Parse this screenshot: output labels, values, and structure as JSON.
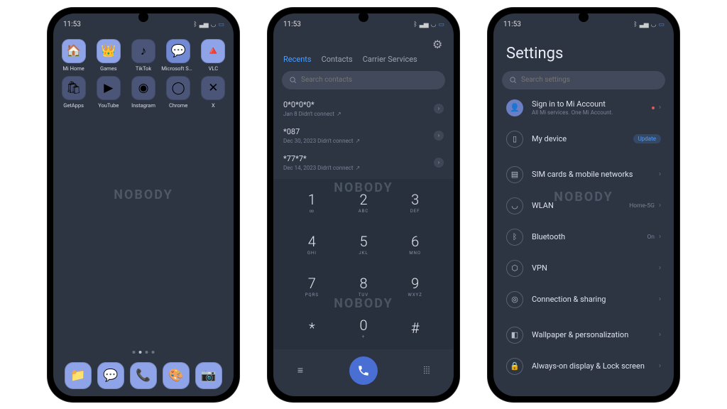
{
  "status": {
    "time": "11:53"
  },
  "watermark": "NOBODY",
  "home": {
    "apps_row1": [
      {
        "label": "Mi Home",
        "name": "mi-home"
      },
      {
        "label": "Games",
        "name": "games"
      },
      {
        "label": "TikTok",
        "name": "tiktok"
      },
      {
        "label": "Microsoft SwiftKey ...",
        "name": "swiftkey"
      },
      {
        "label": "VLC",
        "name": "vlc"
      }
    ],
    "apps_row2": [
      {
        "label": "GetApps",
        "name": "getapps"
      },
      {
        "label": "YouTube",
        "name": "youtube"
      },
      {
        "label": "Instagram",
        "name": "instagram"
      },
      {
        "label": "Chrome",
        "name": "chrome"
      },
      {
        "label": "X",
        "name": "x"
      }
    ],
    "dock": [
      "files",
      "messages",
      "phone",
      "themes",
      "camera"
    ]
  },
  "dialer": {
    "tabs": {
      "recents": "Recents",
      "contacts": "Contacts",
      "carrier": "Carrier Services"
    },
    "search_placeholder": "Search contacts",
    "log": [
      {
        "number": "0*0*0*0*",
        "meta": "Jan 8 Didn't connect"
      },
      {
        "number": "*087",
        "meta": "Dec 30, 2023 Didn't connect"
      },
      {
        "number": "*77*7*",
        "meta": "Dec 14, 2023 Didn't connect"
      }
    ],
    "keys": [
      {
        "n": "1",
        "s": "∞"
      },
      {
        "n": "2",
        "s": "ABC"
      },
      {
        "n": "3",
        "s": "DEF"
      },
      {
        "n": "4",
        "s": "GHI"
      },
      {
        "n": "5",
        "s": "JKL"
      },
      {
        "n": "6",
        "s": "MNO"
      },
      {
        "n": "7",
        "s": "PQRS"
      },
      {
        "n": "8",
        "s": "TUV"
      },
      {
        "n": "9",
        "s": "WXYZ"
      },
      {
        "n": "*",
        "s": ""
      },
      {
        "n": "0",
        "s": "+"
      },
      {
        "n": "#",
        "s": ""
      }
    ]
  },
  "settings": {
    "title": "Settings",
    "search_placeholder": "Search settings",
    "account": {
      "title": "Sign in to Mi Account",
      "sub": "All Mi services. One Mi Account."
    },
    "device": {
      "label": "My device",
      "badge": "Update"
    },
    "items": [
      {
        "label": "SIM cards & mobile networks",
        "icon": "sim"
      },
      {
        "label": "WLAN",
        "right": "Home-5G",
        "icon": "wifi"
      },
      {
        "label": "Bluetooth",
        "right": "On",
        "icon": "bt"
      },
      {
        "label": "VPN",
        "icon": "vpn"
      },
      {
        "label": "Connection & sharing",
        "icon": "share"
      }
    ],
    "items2": [
      {
        "label": "Wallpaper & personalization",
        "icon": "wall"
      },
      {
        "label": "Always-on display & Lock screen",
        "icon": "lock"
      }
    ]
  }
}
